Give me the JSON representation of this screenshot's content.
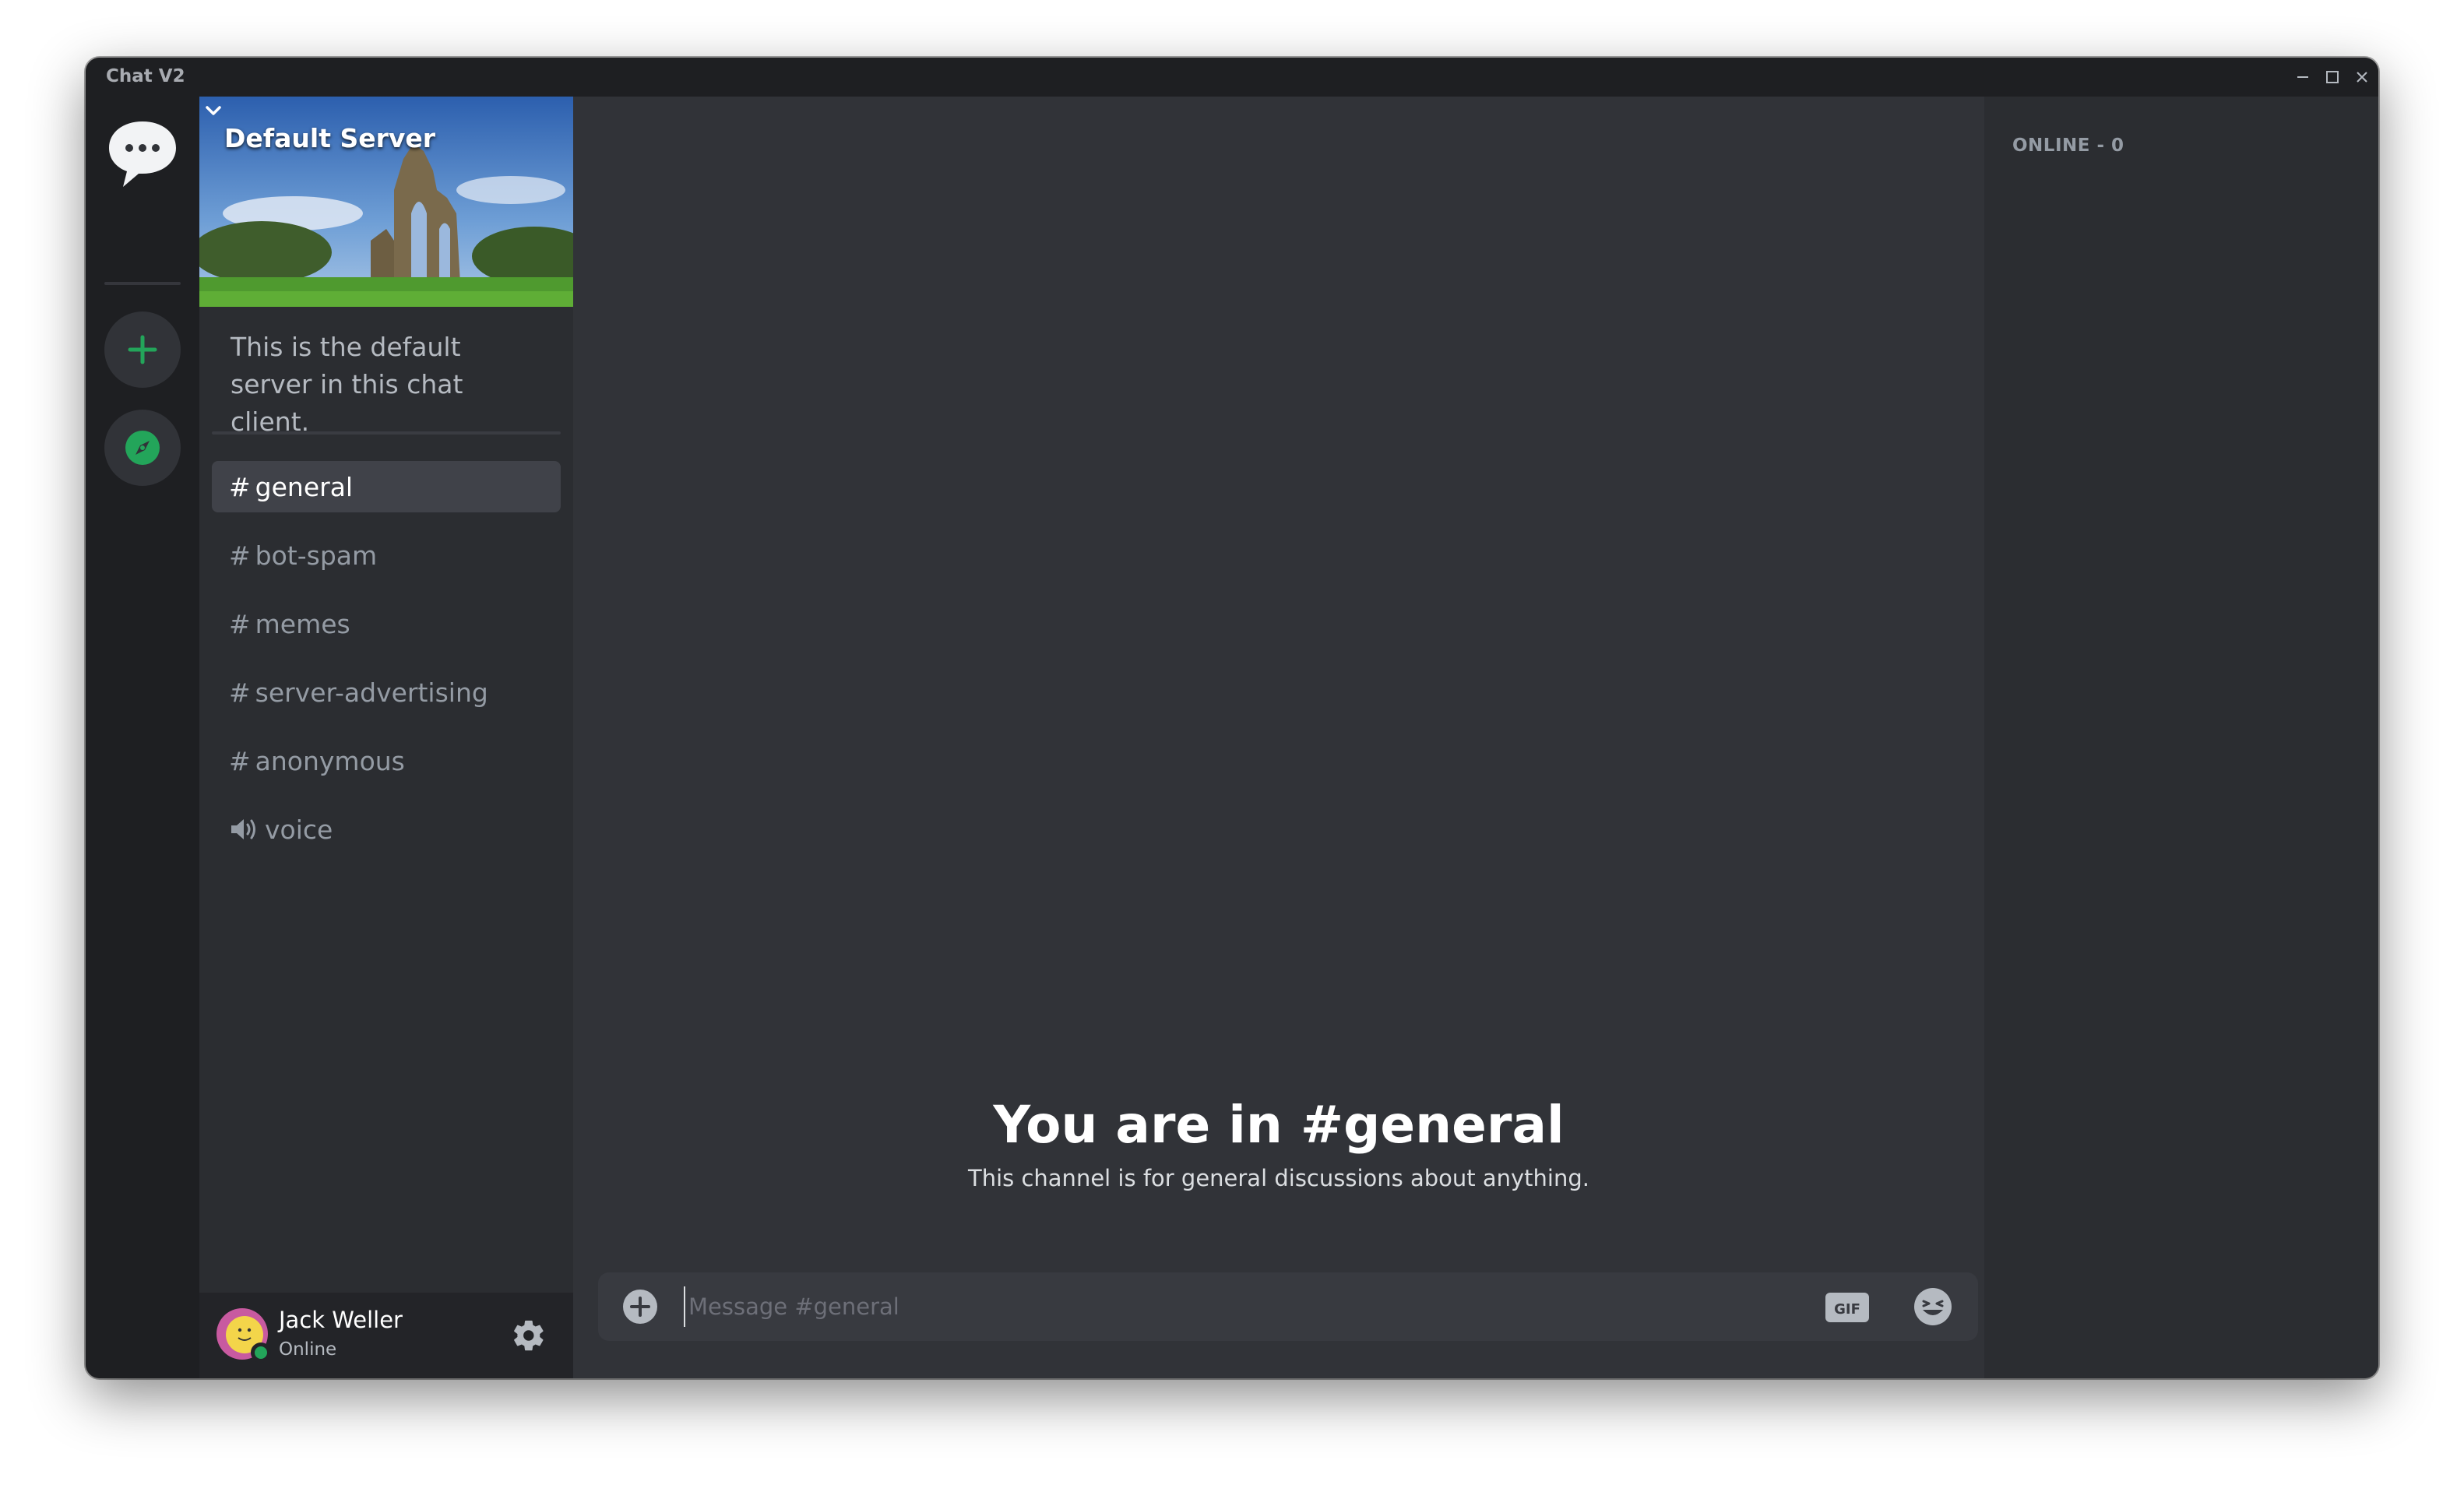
{
  "window": {
    "title": "Chat V2"
  },
  "server": {
    "name": "Default Server",
    "description": "This is the default server in this chat client."
  },
  "channels": [
    {
      "name": "general",
      "type": "text",
      "active": true
    },
    {
      "name": "bot-spam",
      "type": "text",
      "active": false
    },
    {
      "name": "memes",
      "type": "text",
      "active": false
    },
    {
      "name": "server-advertising",
      "type": "text",
      "active": false
    },
    {
      "name": "anonymous",
      "type": "text",
      "active": false
    },
    {
      "name": "voice",
      "type": "voice",
      "active": false
    }
  ],
  "user": {
    "name": "Jack Weller",
    "status": "Online"
  },
  "main": {
    "welcome_title": "You are in #general",
    "welcome_subtitle": "This channel is for general discussions about anything.",
    "composer_placeholder": "Message #general",
    "gif_label": "GIF"
  },
  "members": {
    "header": "ONLINE - 0"
  },
  "colors": {
    "accent_green": "#23a55a",
    "background": "#313338",
    "sidebar": "#2b2d31",
    "rail": "#1e1f22"
  },
  "icons": {
    "home": "speech-bubble-icon",
    "add_server": "plus-icon",
    "explore": "compass-icon",
    "settings": "gear-icon",
    "attach": "plus-circle-icon",
    "gif": "gif-icon",
    "emoji": "emoji-icon",
    "voice": "speaker-icon"
  }
}
